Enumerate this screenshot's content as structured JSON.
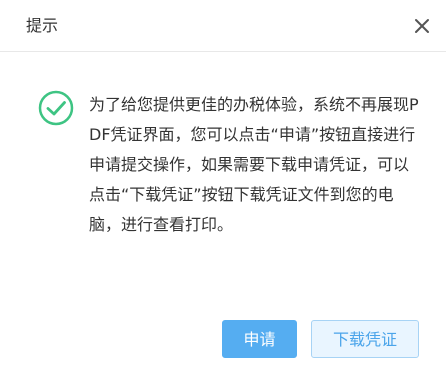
{
  "dialog": {
    "title": "提示",
    "close_icon": "close-icon",
    "success_icon": "check-circle-icon",
    "message": "为了给您提供更佳的办税体验，系统不再展现PDF凭证界面，您可以点击“申请”按钮直接进行申请提交操作，如果需要下载申请凭证，可以点击“下载凭证”按钮下载凭证文件到您的电脑，进行查看打印。",
    "buttons": {
      "apply_label": "申请",
      "download_label": "下载凭证"
    }
  },
  "colors": {
    "success_green": "#3ec483",
    "primary_blue": "#55adf1",
    "secondary_bg": "#e9f5ff",
    "secondary_text": "#4aa4ea"
  }
}
